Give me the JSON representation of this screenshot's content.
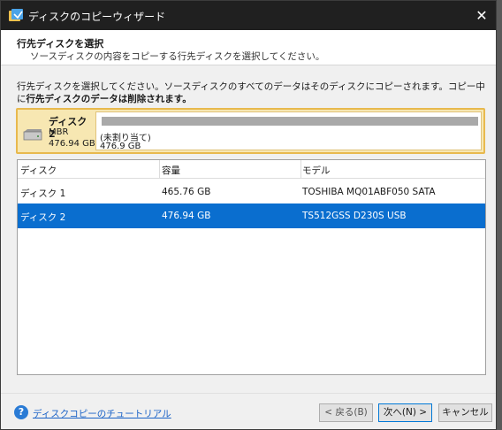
{
  "window": {
    "title": "ディスクのコピーウィザード",
    "close_glyph": "✕"
  },
  "header": {
    "title": "行先ディスクを選択",
    "subtitle": "ソースディスクの内容をコピーする行先ディスクを選択してください。"
  },
  "instruction": {
    "line_normal": "行先ディスクを選択してください。ソースディスクのすべてのデータはそのディスクにコピーされます。コピー中に",
    "line_bold": "行先ディスクのデータは削除されます。"
  },
  "disk_map": {
    "name": "ディスク 2",
    "partition_style": "MBR",
    "size": "476.94 GB",
    "partition_label": "(未割り当て)",
    "partition_size": "476.9 GB"
  },
  "table": {
    "columns": [
      "ディスク",
      "容量",
      "モデル"
    ],
    "rows": [
      {
        "disk": "ディスク 1",
        "capacity": "465.76 GB",
        "model": "TOSHIBA MQ01ABF050 SATA"
      },
      {
        "disk": "ディスク 2",
        "capacity": "476.94 GB",
        "model": "TS512GSS D230S USB"
      }
    ],
    "selected_index": 1
  },
  "footer": {
    "help_glyph": "?",
    "tutorial_link": "ディスクコピーのチュートリアル",
    "back_label": "< 戻る(B)",
    "next_label": "次へ(N) >",
    "cancel_label": "キャンセル"
  },
  "colors": {
    "selection": "#0a6ecf",
    "disk_map_bg": "#f7e7b2",
    "disk_map_border": "#e8b94e",
    "link": "#1a62c7"
  }
}
